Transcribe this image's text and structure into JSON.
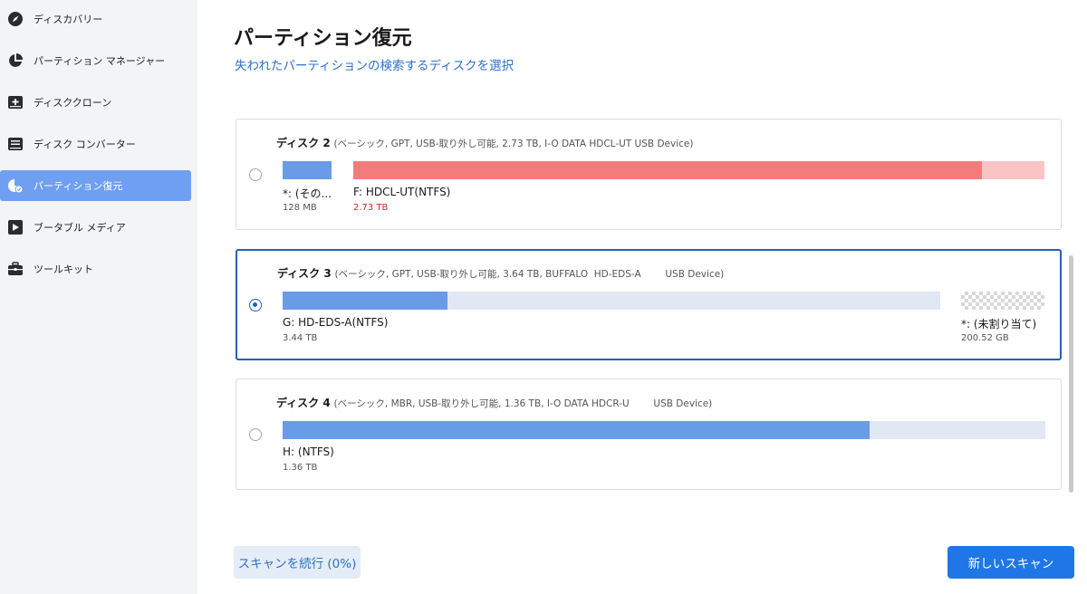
{
  "sidebar": {
    "items": [
      {
        "label": "ディスカバリー",
        "icon": "compass-icon"
      },
      {
        "label": "パーティション マネージャー",
        "icon": "pie-chart-icon"
      },
      {
        "label": "ディスククローン",
        "icon": "disk-clone-icon"
      },
      {
        "label": "ディスク コンバーター",
        "icon": "disk-converter-icon"
      },
      {
        "label": "パーティション復元",
        "icon": "partition-recovery-icon",
        "active": true
      },
      {
        "label": "ブータブル メディア",
        "icon": "bootable-media-icon"
      },
      {
        "label": "ツールキット",
        "icon": "toolbox-icon"
      }
    ]
  },
  "main": {
    "title": "パーティション復元",
    "subtitle": "失われたパーティションの検索するディスクを選択"
  },
  "disks": [
    {
      "name": "ディスク 2",
      "details": "(ベーシック, GPT, USB-取り外し可能, 2.73 TB, I-O DATA HDCL-UT USB Device)",
      "selected": false,
      "partitions": [
        {
          "label": "*: (その...",
          "size": "128 MB",
          "color": "#6a9be8",
          "fill": 1.0
        },
        {
          "label": "F: HDCL-UT(NTFS)",
          "size": "2.73 TB",
          "color": "#f27c7c",
          "track": "#fbc4c4",
          "fill": 0.91
        }
      ]
    },
    {
      "name": "ディスク 3",
      "details": "(ベーシック, GPT, USB-取り外し可能, 3.64 TB, BUFFALO  HD-EDS-A        USB Device)",
      "selected": true,
      "partitions": [
        {
          "label": "G: HD-EDS-A(NTFS)",
          "size": "3.44 TB",
          "color": "#6a9be8",
          "track": "#e1e7f3",
          "fill": 0.25
        },
        {
          "label": "*: (未割り当て)",
          "size": "200.52 GB",
          "unallocated": true
        }
      ]
    },
    {
      "name": "ディスク 4",
      "details": "(ベーシック, MBR, USB-取り外し可能, 1.36 TB, I-O DATA HDCR-U        USB Device)",
      "selected": false,
      "partitions": [
        {
          "label": "H: (NTFS)",
          "size": "1.36 TB",
          "color": "#6a9be8",
          "track": "#e1e7f3",
          "fill": 0.77
        }
      ]
    }
  ],
  "footer": {
    "continue_label": "スキャンを続行 (0%)",
    "new_scan_label": "新しいスキャン"
  },
  "colors": {
    "accent": "#1f76e6",
    "sidebar_active": "#6f9ff0",
    "link": "#2f72c4",
    "selected_border": "#2460b8"
  }
}
